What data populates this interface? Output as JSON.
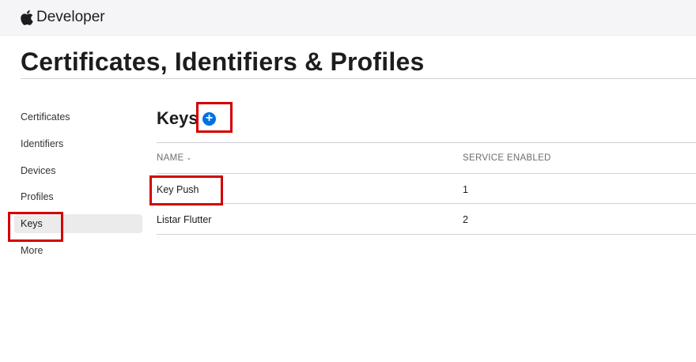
{
  "header": {
    "brand": "Developer"
  },
  "page": {
    "title": "Certificates, Identifiers & Profiles"
  },
  "sidebar": {
    "items": [
      {
        "label": "Certificates"
      },
      {
        "label": "Identifiers"
      },
      {
        "label": "Devices"
      },
      {
        "label": "Profiles"
      },
      {
        "label": "Keys",
        "active": true
      },
      {
        "label": "More"
      }
    ]
  },
  "keys": {
    "title": "Keys",
    "add_glyph": "+",
    "columns": {
      "name": "NAME",
      "sort_glyph": "⌄",
      "service": "SERVICE ENABLED"
    },
    "rows": [
      {
        "name": "Key Push",
        "services": "1"
      },
      {
        "name": "Listar Flutter",
        "services": "2"
      }
    ]
  },
  "colors": {
    "accent": "#0071e3",
    "highlight": "#d20000",
    "topbar": "#f5f5f7"
  }
}
